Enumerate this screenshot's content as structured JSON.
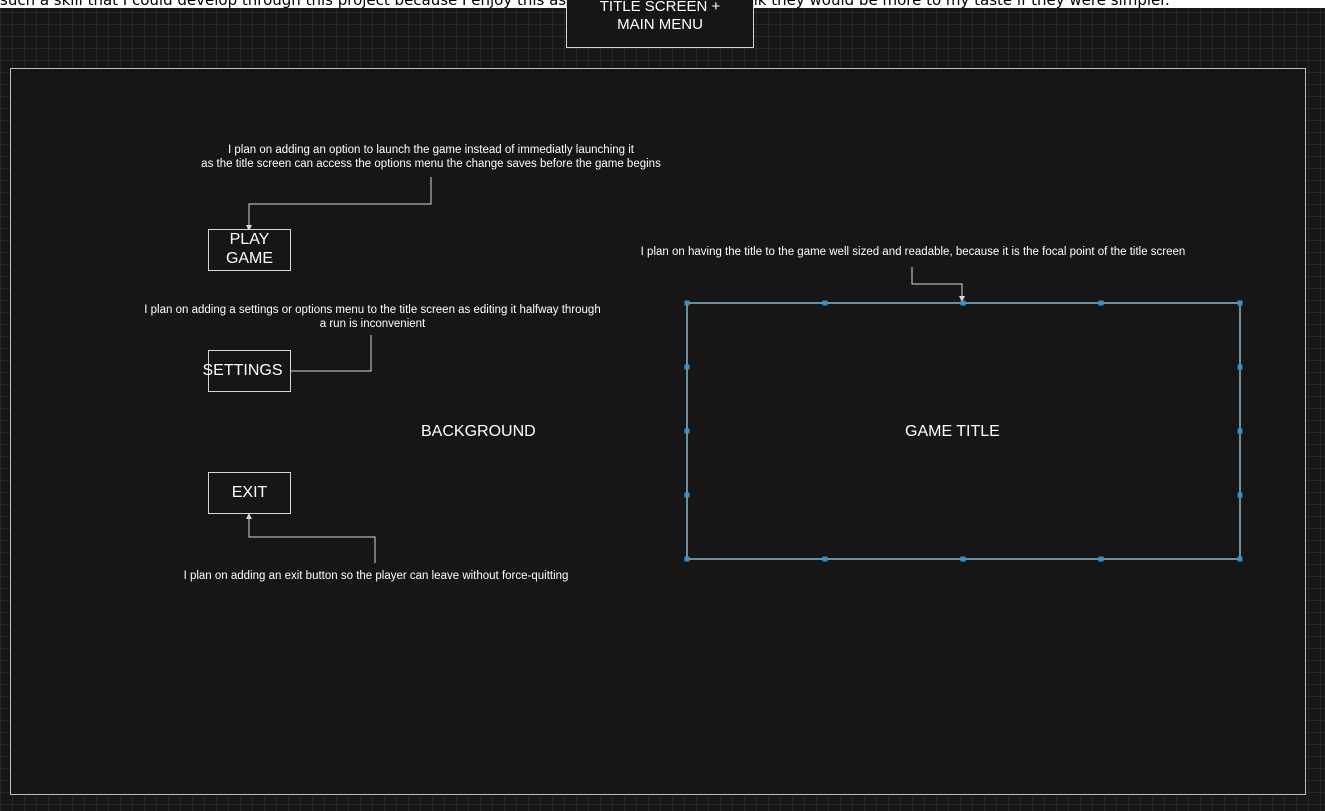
{
  "top_strip_text": "such a skill that I could develop through this project because I enjoy this aspect of the process. I think they would be more to my taste if they were simpler.",
  "page_title": {
    "line1": "TITLE SCREEN +",
    "line2": "MAIN MENU"
  },
  "buttons": {
    "play_line1": "PLAY",
    "play_line2": "GAME",
    "settings": "SETTINGS",
    "exit": "EXIT"
  },
  "labels": {
    "background": "BACKGROUND",
    "game_title": "GAME TITLE"
  },
  "notes": {
    "play_line1": "I plan on adding an option to launch the game instead of immediatly launching it",
    "play_line2": "as the title screen can access the options menu the change saves before the game begins",
    "settings_line1": "I plan on adding a settings or options menu to the title screen as editing it halfway through",
    "settings_line2": "a run is inconvenient",
    "title": "I plan on having the title to the game well sized and readable, because it is the focal point of the title screen",
    "exit": "I plan on adding an exit button so the player can leave without force-quitting"
  },
  "colors": {
    "background": "#161616",
    "grid": "#262626",
    "frame": "#bdbdbd",
    "text": "#ffffff",
    "selection": "#3a8fd0",
    "selected_border": "#8db3c9"
  }
}
